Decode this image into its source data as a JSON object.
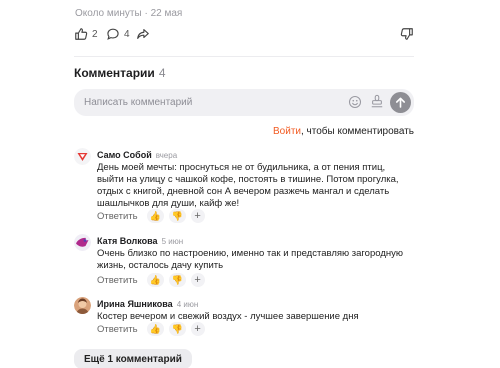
{
  "article": {
    "read_time": "Около минуты",
    "date": "22 мая",
    "likes": "2",
    "comments": "4"
  },
  "comments_section": {
    "title": "Комментарии",
    "count": "4",
    "placeholder": "Написать комментарий",
    "login_link": "Войти",
    "login_text": ", чтобы комментировать",
    "reply_label": "Ответить",
    "more_label": "Ещё 1 комментарий"
  },
  "comments": [
    {
      "author": "Само Собой",
      "date": "вчера",
      "text": "День моей мечты: проснуться не от будильника, а от пения птиц, выйти на улицу с чашкой кофе, постоять в тишине. Потом прогулка, отдых с книгой, дневной сон А вечером разжечь мангал и сделать шашлычков для души, кайф же!"
    },
    {
      "author": "Катя Волкова",
      "date": "5 июн",
      "text": "Очень близко по настроению, именно так и представляю загородную жизнь, осталось дачу купить"
    },
    {
      "author": "Ирина Яшникова",
      "date": "4 июн",
      "text": "Костер вечером и свежий воздух - лучшее завершение дня"
    }
  ],
  "colors": {
    "accent_link": "#f25b22",
    "send_button": "#8e8e94",
    "input_bg": "#f0f0f3"
  }
}
